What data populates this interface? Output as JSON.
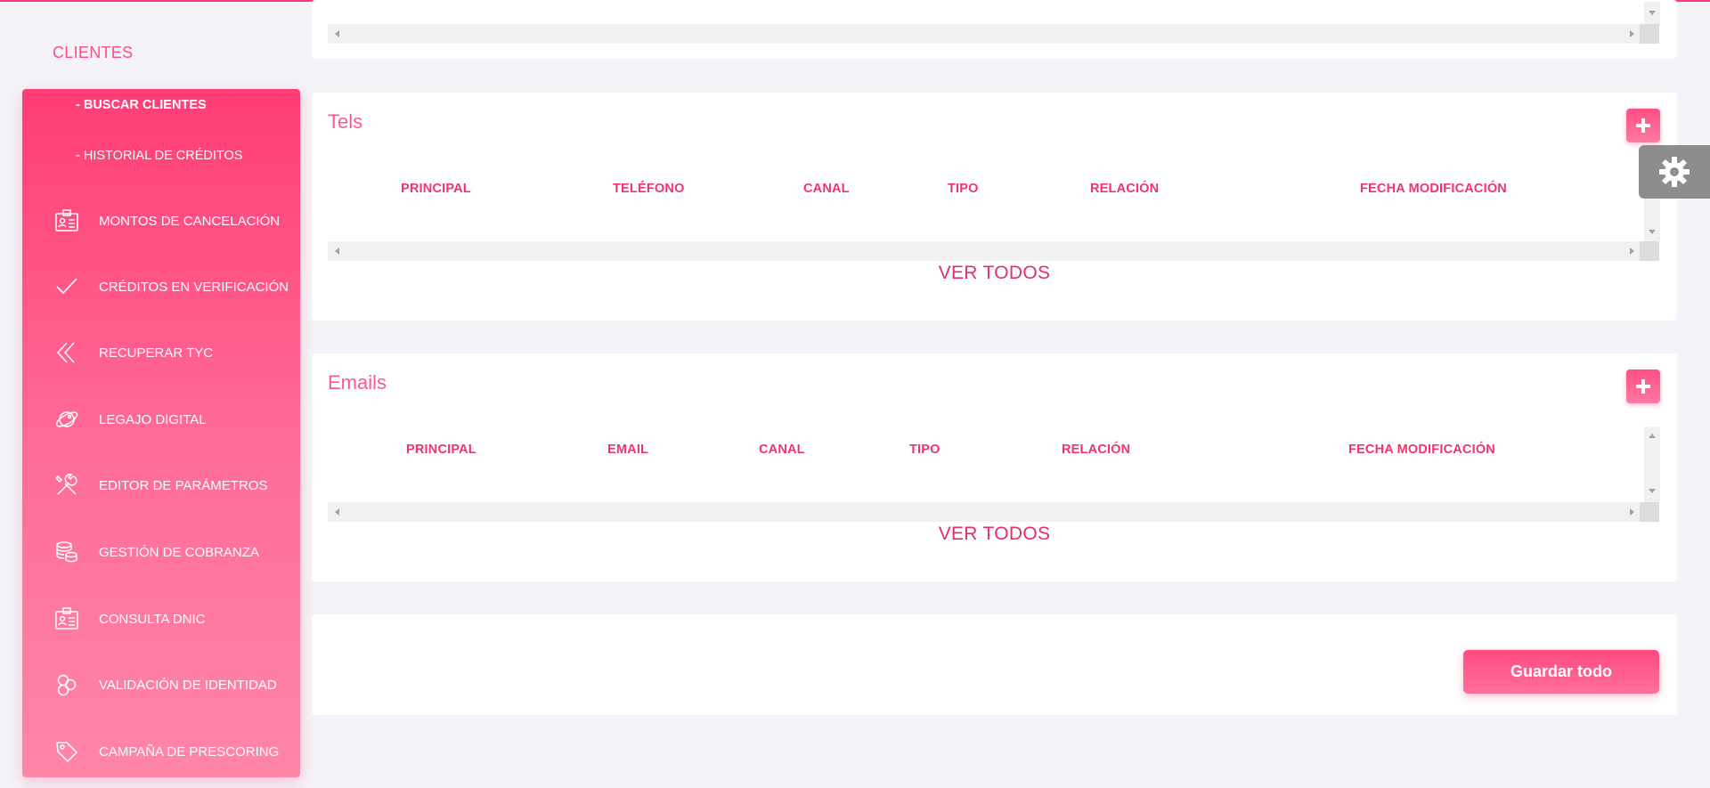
{
  "section": {
    "title": "CLIENTES"
  },
  "sidebar": {
    "sub_items": [
      {
        "label": "- BUSCAR CLIENTES",
        "active": true
      },
      {
        "label": "- HISTORIAL DE CRÉDITOS",
        "active": false
      }
    ],
    "items": [
      {
        "label": "MONTOS DE CANCELACIÓN",
        "icon": "id-card-icon"
      },
      {
        "label": "CRÉDITOS EN VERIFICACIÓN",
        "icon": "check-icon"
      },
      {
        "label": "RECUPERAR TYC",
        "icon": "double-chevron-left-icon"
      },
      {
        "label": "LEGAJO DIGITAL",
        "icon": "planet-icon"
      },
      {
        "label": "EDITOR DE PARÁMETROS",
        "icon": "tools-icon"
      },
      {
        "label": "GESTIÓN DE COBRANZA",
        "icon": "coins-icon"
      },
      {
        "label": "CONSULTA DNIC",
        "icon": "id-card-icon"
      },
      {
        "label": "VALIDACIÓN DE IDENTIDAD",
        "icon": "circles-icon"
      },
      {
        "label": "CAMPAÑA DE PRESCORING",
        "icon": "tag-icon"
      }
    ]
  },
  "tels": {
    "title": "Tels",
    "columns": [
      "PRINCIPAL",
      "TELÉFONO",
      "CANAL",
      "TIPO",
      "RELACIÓN",
      "FECHA MODIFICACIÓN"
    ],
    "view_all": "VER TODOS"
  },
  "emails": {
    "title": "Emails",
    "columns": [
      "PRINCIPAL",
      "EMAIL",
      "CANAL",
      "TIPO",
      "RELACIÓN",
      "FECHA MODIFICACIÓN"
    ],
    "view_all": "VER TODOS"
  },
  "actions": {
    "save_all": "Guardar todo"
  },
  "colors": {
    "accent": "#ff3d74",
    "header_text": "#f0346c",
    "link": "#e62e64"
  }
}
